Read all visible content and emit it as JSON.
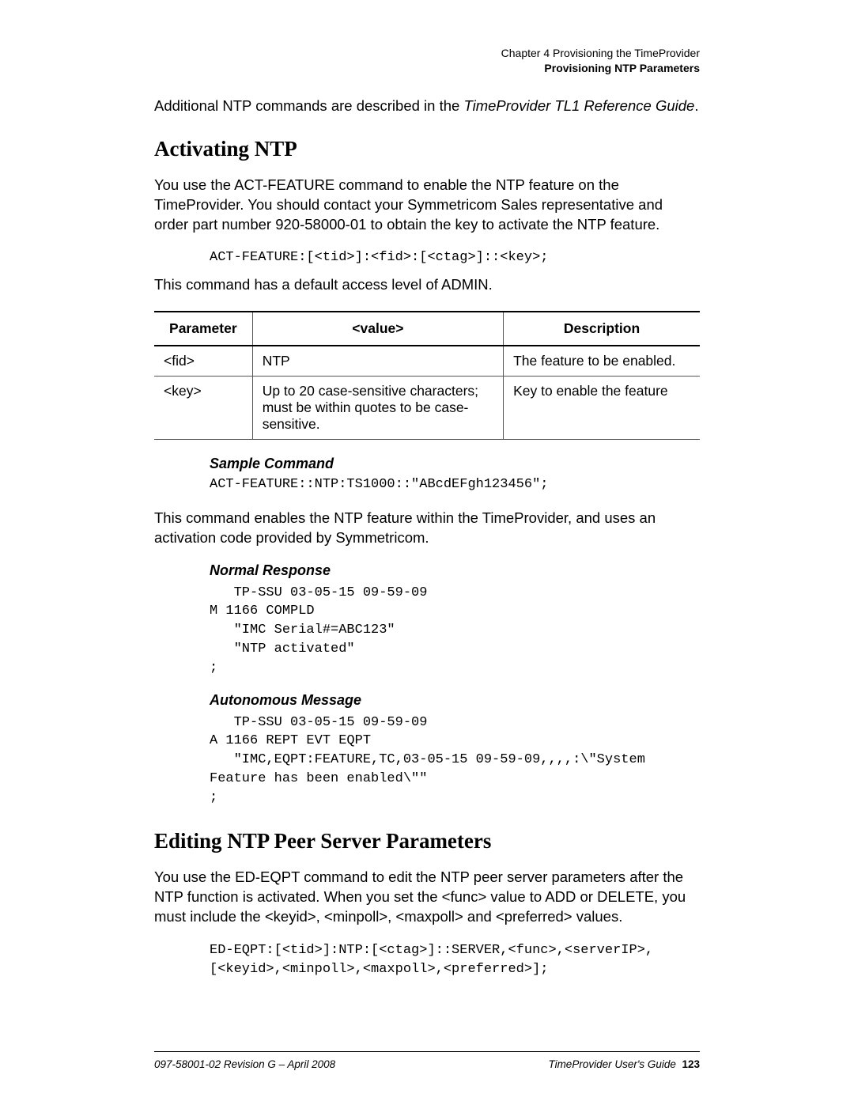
{
  "header": {
    "chapter": "Chapter 4 Provisioning the TimeProvider",
    "section": "Provisioning NTP Parameters"
  },
  "intro": {
    "text_pre": "Additional NTP commands are described in the ",
    "text_italic": "TimeProvider TL1 Reference Guide",
    "text_post": "."
  },
  "sec1": {
    "title": "Activating NTP",
    "p1": "You use the ACT-FEATURE command to enable the NTP feature on the TimeProvider. You should contact your Symmetricom Sales representative and order part number 920-58000-01 to obtain the key to activate the NTP feature.",
    "code1": "ACT-FEATURE:[<tid>]:<fid>:[<ctag>]::<key>;",
    "p2": "This command has a default access level of ADMIN."
  },
  "table": {
    "headers": {
      "c1": "Parameter",
      "c2": "<value>",
      "c3": "Description"
    },
    "rows": [
      {
        "c1": "<fid>",
        "c2": "NTP",
        "c3": "The feature to be enabled."
      },
      {
        "c1": "<key>",
        "c2": "Up to 20 case-sensitive characters; must be within quotes to be case-sensitive.",
        "c3": "Key to enable the feature"
      }
    ]
  },
  "sample": {
    "heading": "Sample Command",
    "code": "ACT-FEATURE::NTP:TS1000::\"ABcdEFgh123456\";"
  },
  "p3": "This command enables the NTP feature within the TimeProvider, and uses an activation code provided by Symmetricom.",
  "normal": {
    "heading": "Normal Response",
    "code": "   TP-SSU 03-05-15 09-59-09\nM 1166 COMPLD\n   \"IMC Serial#=ABC123\"\n   \"NTP activated\"\n;"
  },
  "auto": {
    "heading": "Autonomous Message",
    "code": "   TP-SSU 03-05-15 09-59-09\nA 1166 REPT EVT EQPT\n   \"IMC,EQPT:FEATURE,TC,03-05-15 09-59-09,,,,:\\\"System\nFeature has been enabled\\\"\"\n;"
  },
  "sec2": {
    "title": "Editing NTP Peer Server Parameters",
    "p1": "You use the ED-EQPT command to edit the NTP peer server parameters after the NTP function is activated. When you set the <func> value to ADD or DELETE, you must include the <keyid>, <minpoll>, <maxpoll> and <preferred> values.",
    "code": "ED-EQPT:[<tid>]:NTP:[<ctag>]::SERVER,<func>,<serverIP>,\n[<keyid>,<minpoll>,<maxpoll>,<preferred>];"
  },
  "footer": {
    "left": "097-58001-02 Revision G – April 2008",
    "right_label": "TimeProvider User's Guide",
    "page": "123"
  }
}
